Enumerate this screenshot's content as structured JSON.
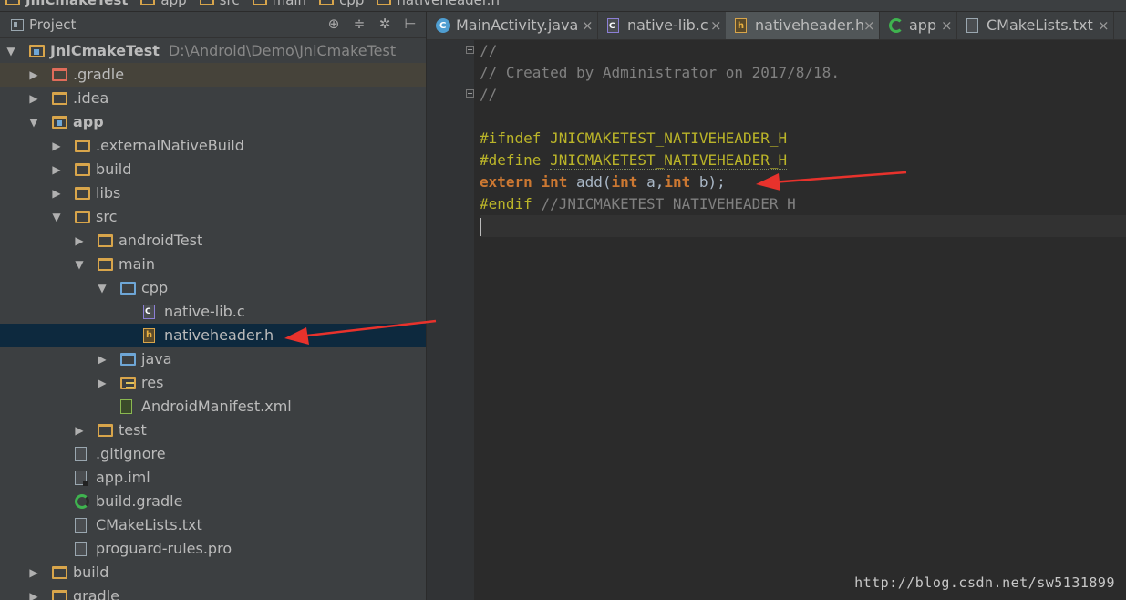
{
  "breadcrumb": [
    "JniCmakeTest",
    "app",
    "src",
    "main",
    "cpp",
    "nativeheader.h"
  ],
  "project_panel": {
    "title": "Project",
    "tool_icons": [
      "target-icon",
      "collapse-icon",
      "gear-icon",
      "hide-icon"
    ]
  },
  "tree": [
    {
      "label": "JniCmakeTest",
      "path": "D:\\Android\\Demo\\JniCmakeTest",
      "depth": 0,
      "arrow": "▼",
      "icon": "module-folder",
      "bold": true
    },
    {
      "label": ".gradle",
      "depth": 1,
      "arrow": "▶",
      "icon": "folder-red",
      "highlight": true
    },
    {
      "label": ".idea",
      "depth": 1,
      "arrow": "▶",
      "icon": "folder"
    },
    {
      "label": "app",
      "depth": 1,
      "arrow": "▼",
      "icon": "module-folder",
      "bold": true
    },
    {
      "label": ".externalNativeBuild",
      "depth": 2,
      "arrow": "▶",
      "icon": "folder"
    },
    {
      "label": "build",
      "depth": 2,
      "arrow": "▶",
      "icon": "folder"
    },
    {
      "label": "libs",
      "depth": 2,
      "arrow": "▶",
      "icon": "folder"
    },
    {
      "label": "src",
      "depth": 2,
      "arrow": "▼",
      "icon": "folder"
    },
    {
      "label": "androidTest",
      "depth": 3,
      "arrow": "▶",
      "icon": "folder"
    },
    {
      "label": "main",
      "depth": 3,
      "arrow": "▼",
      "icon": "folder"
    },
    {
      "label": "cpp",
      "depth": 4,
      "arrow": "▼",
      "icon": "folder-blue"
    },
    {
      "label": "native-lib.c",
      "depth": 5,
      "arrow": "",
      "icon": "c-file"
    },
    {
      "label": "nativeheader.h",
      "depth": 5,
      "arrow": "",
      "icon": "h-file",
      "selected": true
    },
    {
      "label": "java",
      "depth": 4,
      "arrow": "▶",
      "icon": "folder-blue"
    },
    {
      "label": "res",
      "depth": 4,
      "arrow": "▶",
      "icon": "folder-res"
    },
    {
      "label": "AndroidManifest.xml",
      "depth": 4,
      "arrow": "",
      "icon": "xml-file"
    },
    {
      "label": "test",
      "depth": 3,
      "arrow": "▶",
      "icon": "folder"
    },
    {
      "label": ".gitignore",
      "depth": 2,
      "arrow": "",
      "icon": "text-file"
    },
    {
      "label": "app.iml",
      "depth": 2,
      "arrow": "",
      "icon": "iml-file"
    },
    {
      "label": "build.gradle",
      "depth": 2,
      "arrow": "",
      "icon": "gradle-file"
    },
    {
      "label": "CMakeLists.txt",
      "depth": 2,
      "arrow": "",
      "icon": "text-file"
    },
    {
      "label": "proguard-rules.pro",
      "depth": 2,
      "arrow": "",
      "icon": "text-file"
    },
    {
      "label": "build",
      "depth": 1,
      "arrow": "▶",
      "icon": "folder"
    },
    {
      "label": "gradle",
      "depth": 1,
      "arrow": "▶",
      "icon": "folder"
    }
  ],
  "tabs": [
    {
      "label": "MainActivity.java",
      "icon": "java",
      "close": "×",
      "active": false
    },
    {
      "label": "native-lib.c",
      "icon": "cfile",
      "close": "×",
      "active": false
    },
    {
      "label": "nativeheader.h",
      "icon": "hfile",
      "close": "×",
      "active": true
    },
    {
      "label": "app",
      "icon": "gradle",
      "close": "×",
      "active": false
    },
    {
      "label": "CMakeLists.txt",
      "icon": "txt",
      "close": "×",
      "active": false
    }
  ],
  "code": {
    "l1": "//",
    "l2": "// Created by Administrator on 2017/8/18.",
    "l3": "//",
    "l5_dir": "#ifndef",
    "l5_name": "JNICMAKETEST_NATIVEHEADER_H",
    "l6_dir": "#define",
    "l6_name": "JNICMAKETEST_NATIVEHEADER_H",
    "l7_extern": "extern",
    "l7_int1": "int",
    "l7_fn": "add(",
    "l7_int2": "int",
    "l7_a": "a,",
    "l7_int3": "int",
    "l7_b": "b);",
    "l8_dir": "#endif",
    "l8_cm": "//JNICMAKETEST_NATIVEHEADER_H"
  },
  "watermark": "http://blog.csdn.net/sw5131899",
  "colors": {
    "annotation_arrow": "#e8322c",
    "selection": "#0d293e"
  }
}
